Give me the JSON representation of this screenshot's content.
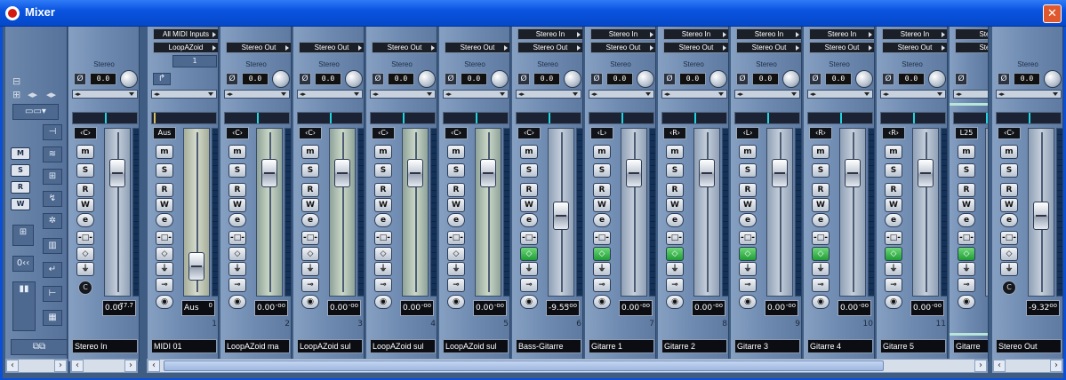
{
  "window": {
    "title": "Mixer",
    "close": "✕"
  },
  "left_panel": {
    "buttons": [
      "M",
      "S",
      "R",
      "W"
    ],
    "footer": "⧉⧉"
  },
  "channels": [
    {
      "name": "Stereo In",
      "input": "",
      "output": "",
      "sublabel": "Stereo",
      "pan": "0.0",
      "pan_text": "‹C›",
      "vol": "0.00",
      "peak": "-77.7",
      "fader": 0.8,
      "num": "",
      "kind": "stereo"
    },
    {
      "name": "MIDI 01",
      "input": "All MIDI Inputs",
      "output": "LoopAZoid",
      "midi_ch": "1",
      "tag": "Aus",
      "vol": "Aus",
      "peak": "0",
      "fader": 0.1,
      "num": "1",
      "kind": "midi"
    },
    {
      "name": "LoopAZoid ma",
      "input": "",
      "output": "Stereo Out",
      "sublabel": "Stereo",
      "pan": "0.0",
      "pan_text": "‹C›",
      "vol": "0.00",
      "peak": "-oo",
      "fader": 0.8,
      "num": "2",
      "kind": "audio"
    },
    {
      "name": "LoopAZoid sul",
      "input": "",
      "output": "Stereo Out",
      "sublabel": "Stereo",
      "pan": "0.0",
      "pan_text": "‹C›",
      "vol": "0.00",
      "peak": "-oo",
      "fader": 0.8,
      "num": "3",
      "kind": "audio"
    },
    {
      "name": "LoopAZoid sul",
      "input": "",
      "output": "Stereo Out",
      "sublabel": "Stereo",
      "pan": "0.0",
      "pan_text": "‹C›",
      "vol": "0.00",
      "peak": "-oo",
      "fader": 0.8,
      "num": "4",
      "kind": "audio"
    },
    {
      "name": "LoopAZoid sul",
      "input": "",
      "output": "Stereo Out",
      "sublabel": "Stereo",
      "pan": "0.0",
      "pan_text": "‹C›",
      "vol": "0.00",
      "peak": "-oo",
      "fader": 0.8,
      "num": "5",
      "kind": "audio"
    },
    {
      "name": "Bass-Gitarre",
      "input": "Stereo In",
      "output": "Stereo Out",
      "sublabel": "Stereo",
      "pan": "0.0",
      "pan_text": "‹C›",
      "vol": "-9.55",
      "peak": "-oo",
      "fader": 0.48,
      "num": "6",
      "kind": "track"
    },
    {
      "name": "Gitarre 1",
      "input": "Stereo In",
      "output": "Stereo Out",
      "sublabel": "Stereo",
      "pan": "0.0",
      "pan_text": "‹L›",
      "vol": "0.00",
      "peak": "-oo",
      "fader": 0.8,
      "num": "7",
      "kind": "track"
    },
    {
      "name": "Gitarre 2",
      "input": "Stereo In",
      "output": "Stereo Out",
      "sublabel": "Stereo",
      "pan": "0.0",
      "pan_text": "‹R›",
      "vol": "0.00",
      "peak": "-oo",
      "fader": 0.8,
      "num": "8",
      "kind": "track"
    },
    {
      "name": "Gitarre 3",
      "input": "Stereo In",
      "output": "Stereo Out",
      "sublabel": "Stereo",
      "pan": "0.0",
      "pan_text": "‹L›",
      "vol": "0.00",
      "peak": "-oo",
      "fader": 0.8,
      "num": "9",
      "kind": "track"
    },
    {
      "name": "Gitarre 4",
      "input": "Stereo In",
      "output": "Stereo Out",
      "sublabel": "Stereo",
      "pan": "0.0",
      "pan_text": "‹R›",
      "vol": "0.00",
      "peak": "-oo",
      "fader": 0.8,
      "num": "10",
      "kind": "track"
    },
    {
      "name": "Gitarre 5",
      "input": "Stereo In",
      "output": "Stereo Out",
      "sublabel": "Stereo",
      "pan": "0.0",
      "pan_text": "‹R›",
      "vol": "0.00",
      "peak": "-oo",
      "fader": 0.8,
      "num": "11",
      "kind": "track"
    },
    {
      "name": "Gitarre",
      "input": "Stere",
      "output": "Stere",
      "sublabel": "",
      "pan": "",
      "pan_text": "L25",
      "vol": "",
      "peak": "",
      "fader": 0.8,
      "num": "",
      "kind": "partial"
    },
    {
      "name": "Stereo Out",
      "input": "",
      "output": "",
      "sublabel": "Stereo",
      "pan": "0.0",
      "pan_text": "‹C›",
      "vol": "-9.32",
      "peak": "-oo",
      "fader": 0.48,
      "num": "",
      "kind": "stereo"
    }
  ],
  "labels": {
    "m": "m",
    "s": "S",
    "r": "R",
    "w": "W",
    "e": "e",
    "arrows": "◂▸"
  },
  "colors": {
    "meter_cyan": "#22d3e0",
    "green_button": "#1f9c35",
    "record_red": "#d73a2a"
  }
}
